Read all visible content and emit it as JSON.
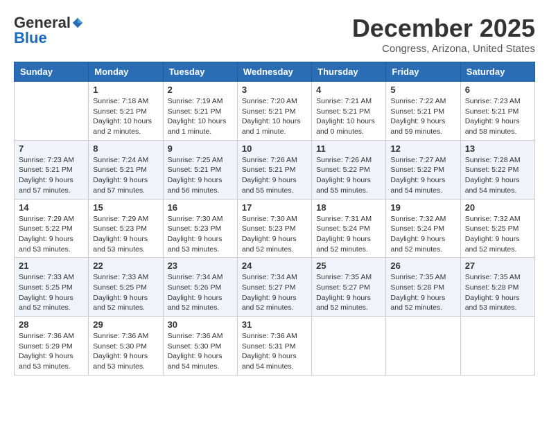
{
  "logo": {
    "text1": "General",
    "text2": "Blue"
  },
  "title": "December 2025",
  "location": "Congress, Arizona, United States",
  "weekdays": [
    "Sunday",
    "Monday",
    "Tuesday",
    "Wednesday",
    "Thursday",
    "Friday",
    "Saturday"
  ],
  "weeks": [
    [
      {
        "day": "",
        "sunrise": "",
        "sunset": "",
        "daylight": ""
      },
      {
        "day": "1",
        "sunrise": "Sunrise: 7:18 AM",
        "sunset": "Sunset: 5:21 PM",
        "daylight": "Daylight: 10 hours and 2 minutes."
      },
      {
        "day": "2",
        "sunrise": "Sunrise: 7:19 AM",
        "sunset": "Sunset: 5:21 PM",
        "daylight": "Daylight: 10 hours and 1 minute."
      },
      {
        "day": "3",
        "sunrise": "Sunrise: 7:20 AM",
        "sunset": "Sunset: 5:21 PM",
        "daylight": "Daylight: 10 hours and 1 minute."
      },
      {
        "day": "4",
        "sunrise": "Sunrise: 7:21 AM",
        "sunset": "Sunset: 5:21 PM",
        "daylight": "Daylight: 10 hours and 0 minutes."
      },
      {
        "day": "5",
        "sunrise": "Sunrise: 7:22 AM",
        "sunset": "Sunset: 5:21 PM",
        "daylight": "Daylight: 9 hours and 59 minutes."
      },
      {
        "day": "6",
        "sunrise": "Sunrise: 7:23 AM",
        "sunset": "Sunset: 5:21 PM",
        "daylight": "Daylight: 9 hours and 58 minutes."
      }
    ],
    [
      {
        "day": "7",
        "sunrise": "Sunrise: 7:23 AM",
        "sunset": "Sunset: 5:21 PM",
        "daylight": "Daylight: 9 hours and 57 minutes."
      },
      {
        "day": "8",
        "sunrise": "Sunrise: 7:24 AM",
        "sunset": "Sunset: 5:21 PM",
        "daylight": "Daylight: 9 hours and 57 minutes."
      },
      {
        "day": "9",
        "sunrise": "Sunrise: 7:25 AM",
        "sunset": "Sunset: 5:21 PM",
        "daylight": "Daylight: 9 hours and 56 minutes."
      },
      {
        "day": "10",
        "sunrise": "Sunrise: 7:26 AM",
        "sunset": "Sunset: 5:21 PM",
        "daylight": "Daylight: 9 hours and 55 minutes."
      },
      {
        "day": "11",
        "sunrise": "Sunrise: 7:26 AM",
        "sunset": "Sunset: 5:22 PM",
        "daylight": "Daylight: 9 hours and 55 minutes."
      },
      {
        "day": "12",
        "sunrise": "Sunrise: 7:27 AM",
        "sunset": "Sunset: 5:22 PM",
        "daylight": "Daylight: 9 hours and 54 minutes."
      },
      {
        "day": "13",
        "sunrise": "Sunrise: 7:28 AM",
        "sunset": "Sunset: 5:22 PM",
        "daylight": "Daylight: 9 hours and 54 minutes."
      }
    ],
    [
      {
        "day": "14",
        "sunrise": "Sunrise: 7:29 AM",
        "sunset": "Sunset: 5:22 PM",
        "daylight": "Daylight: 9 hours and 53 minutes."
      },
      {
        "day": "15",
        "sunrise": "Sunrise: 7:29 AM",
        "sunset": "Sunset: 5:23 PM",
        "daylight": "Daylight: 9 hours and 53 minutes."
      },
      {
        "day": "16",
        "sunrise": "Sunrise: 7:30 AM",
        "sunset": "Sunset: 5:23 PM",
        "daylight": "Daylight: 9 hours and 53 minutes."
      },
      {
        "day": "17",
        "sunrise": "Sunrise: 7:30 AM",
        "sunset": "Sunset: 5:23 PM",
        "daylight": "Daylight: 9 hours and 52 minutes."
      },
      {
        "day": "18",
        "sunrise": "Sunrise: 7:31 AM",
        "sunset": "Sunset: 5:24 PM",
        "daylight": "Daylight: 9 hours and 52 minutes."
      },
      {
        "day": "19",
        "sunrise": "Sunrise: 7:32 AM",
        "sunset": "Sunset: 5:24 PM",
        "daylight": "Daylight: 9 hours and 52 minutes."
      },
      {
        "day": "20",
        "sunrise": "Sunrise: 7:32 AM",
        "sunset": "Sunset: 5:25 PM",
        "daylight": "Daylight: 9 hours and 52 minutes."
      }
    ],
    [
      {
        "day": "21",
        "sunrise": "Sunrise: 7:33 AM",
        "sunset": "Sunset: 5:25 PM",
        "daylight": "Daylight: 9 hours and 52 minutes."
      },
      {
        "day": "22",
        "sunrise": "Sunrise: 7:33 AM",
        "sunset": "Sunset: 5:25 PM",
        "daylight": "Daylight: 9 hours and 52 minutes."
      },
      {
        "day": "23",
        "sunrise": "Sunrise: 7:34 AM",
        "sunset": "Sunset: 5:26 PM",
        "daylight": "Daylight: 9 hours and 52 minutes."
      },
      {
        "day": "24",
        "sunrise": "Sunrise: 7:34 AM",
        "sunset": "Sunset: 5:27 PM",
        "daylight": "Daylight: 9 hours and 52 minutes."
      },
      {
        "day": "25",
        "sunrise": "Sunrise: 7:35 AM",
        "sunset": "Sunset: 5:27 PM",
        "daylight": "Daylight: 9 hours and 52 minutes."
      },
      {
        "day": "26",
        "sunrise": "Sunrise: 7:35 AM",
        "sunset": "Sunset: 5:28 PM",
        "daylight": "Daylight: 9 hours and 52 minutes."
      },
      {
        "day": "27",
        "sunrise": "Sunrise: 7:35 AM",
        "sunset": "Sunset: 5:28 PM",
        "daylight": "Daylight: 9 hours and 53 minutes."
      }
    ],
    [
      {
        "day": "28",
        "sunrise": "Sunrise: 7:36 AM",
        "sunset": "Sunset: 5:29 PM",
        "daylight": "Daylight: 9 hours and 53 minutes."
      },
      {
        "day": "29",
        "sunrise": "Sunrise: 7:36 AM",
        "sunset": "Sunset: 5:30 PM",
        "daylight": "Daylight: 9 hours and 53 minutes."
      },
      {
        "day": "30",
        "sunrise": "Sunrise: 7:36 AM",
        "sunset": "Sunset: 5:30 PM",
        "daylight": "Daylight: 9 hours and 54 minutes."
      },
      {
        "day": "31",
        "sunrise": "Sunrise: 7:36 AM",
        "sunset": "Sunset: 5:31 PM",
        "daylight": "Daylight: 9 hours and 54 minutes."
      },
      {
        "day": "",
        "sunrise": "",
        "sunset": "",
        "daylight": ""
      },
      {
        "day": "",
        "sunrise": "",
        "sunset": "",
        "daylight": ""
      },
      {
        "day": "",
        "sunrise": "",
        "sunset": "",
        "daylight": ""
      }
    ]
  ]
}
